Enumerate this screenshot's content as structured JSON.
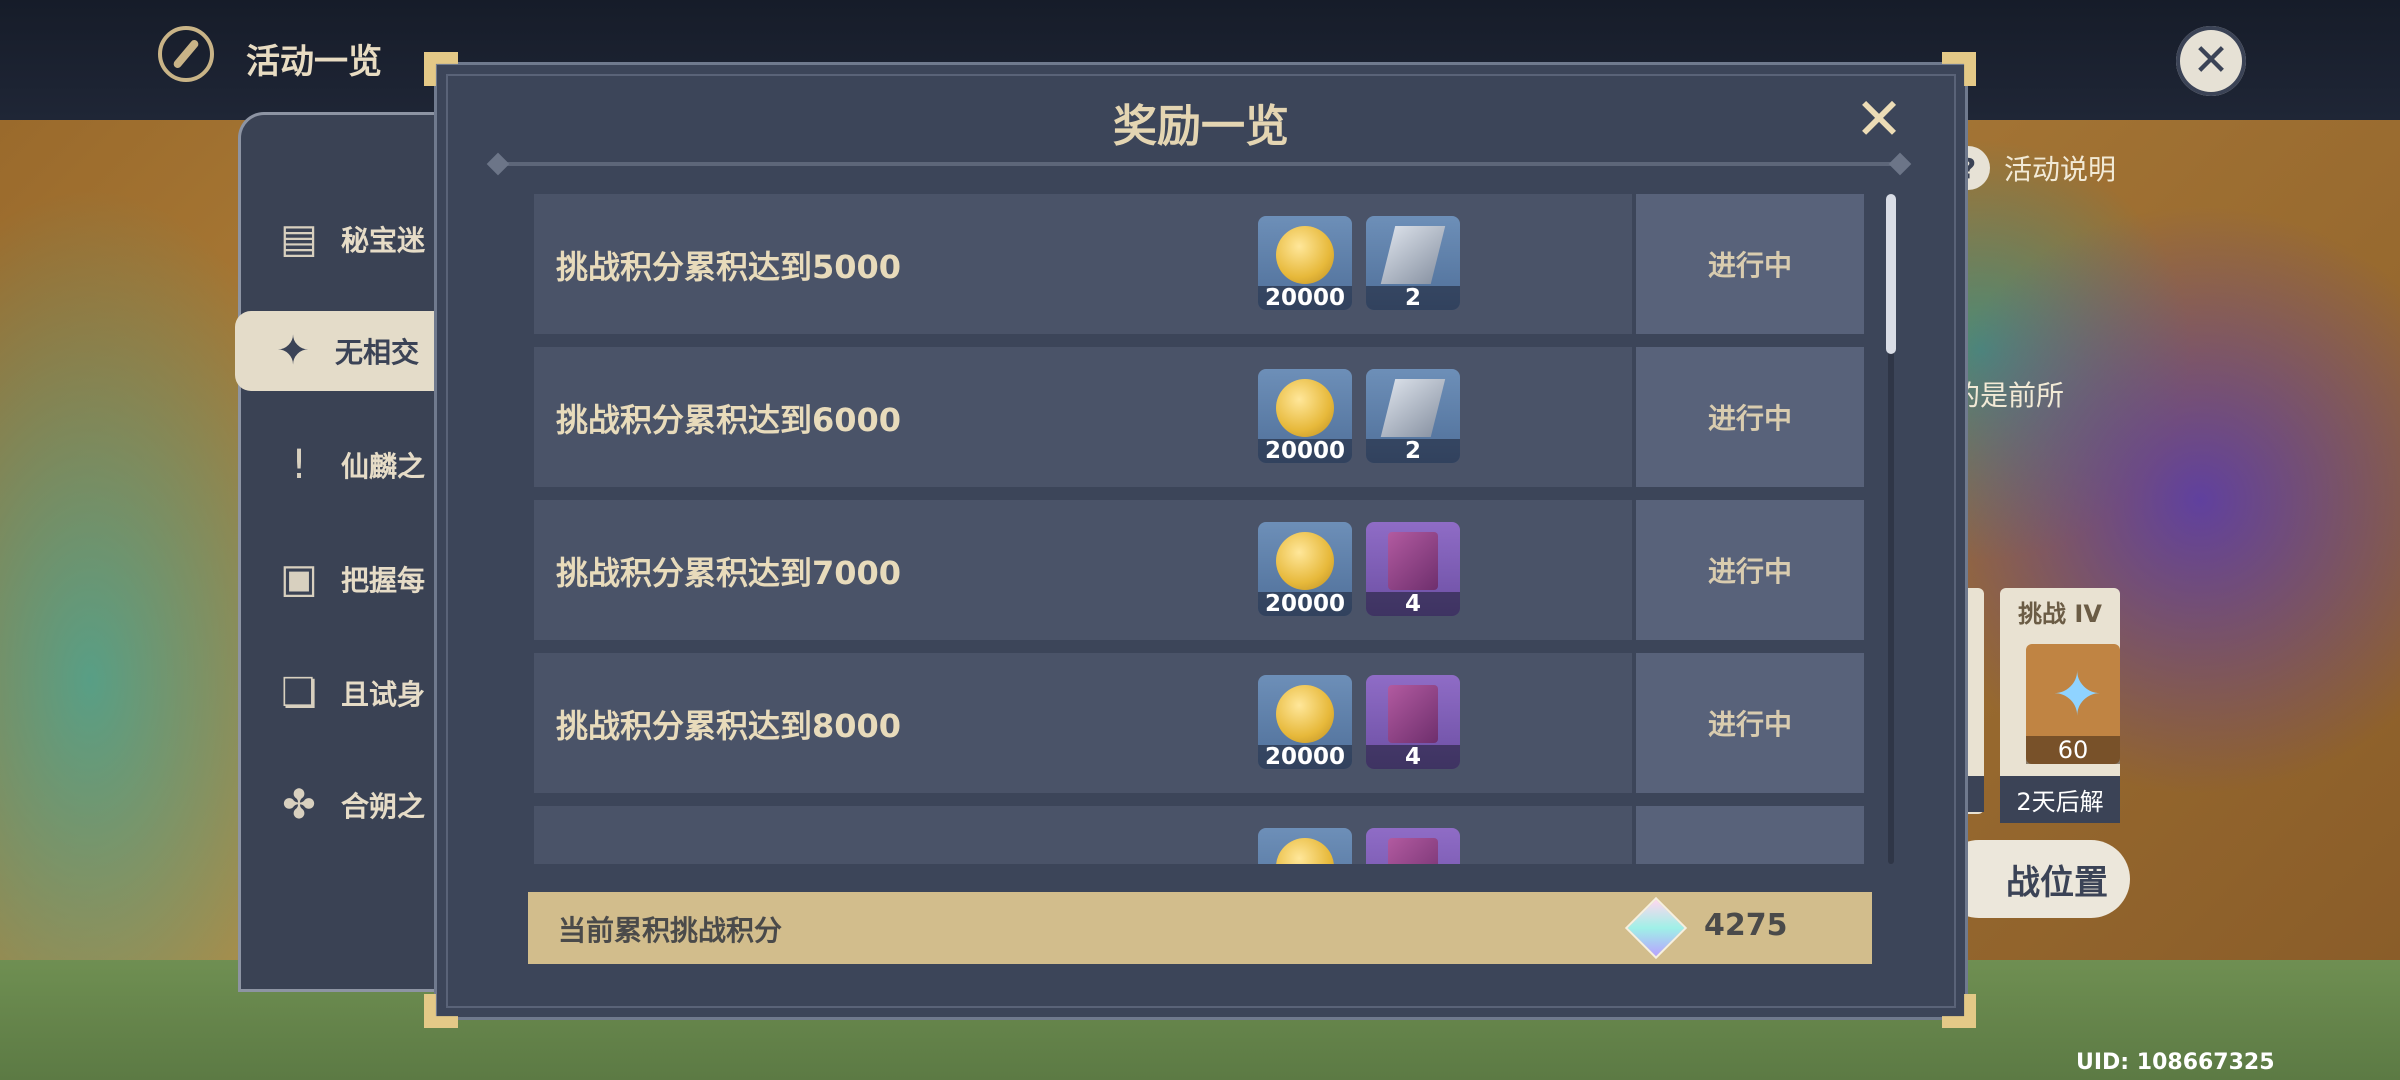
{
  "header": {
    "title": "活动一览"
  },
  "sidebar": {
    "items": [
      {
        "label": "秘宝迷",
        "icon": "chest-icon",
        "active": false
      },
      {
        "label": "无相交",
        "icon": "four-point-star-icon",
        "active": true
      },
      {
        "label": "仙麟之",
        "icon": "exclamation-icon",
        "active": false
      },
      {
        "label": "把握每",
        "icon": "calendar-icon",
        "active": false
      },
      {
        "label": "且试身",
        "icon": "cards-icon",
        "active": false
      },
      {
        "label": "合朔之",
        "icon": "tree-emblem-icon",
        "active": false
      }
    ]
  },
  "background": {
    "help_label": "活动说明",
    "description_fragment": "的是前所",
    "challenge_card": {
      "title": "挑战 IV",
      "count": "60",
      "status": "2天后解"
    },
    "position_button": "战位置",
    "uid": "UID: 108667325"
  },
  "modal": {
    "title": "奖励一览",
    "rewards": [
      {
        "condition": "挑战积分累积达到5000",
        "status": "进行中",
        "items": [
          {
            "icon": "mora-coin-icon",
            "count": "20000"
          },
          {
            "icon": "steel-material-icon",
            "count": "2"
          }
        ]
      },
      {
        "condition": "挑战积分累积达到6000",
        "status": "进行中",
        "items": [
          {
            "icon": "mora-coin-icon",
            "count": "20000"
          },
          {
            "icon": "steel-material-icon",
            "count": "2"
          }
        ]
      },
      {
        "condition": "挑战积分累积达到7000",
        "status": "进行中",
        "items": [
          {
            "icon": "mora-coin-icon",
            "count": "20000"
          },
          {
            "icon": "purple-book-icon",
            "count": "4"
          }
        ]
      },
      {
        "condition": "挑战积分累积达到8000",
        "status": "进行中",
        "items": [
          {
            "icon": "mora-coin-icon",
            "count": "20000"
          },
          {
            "icon": "purple-book-icon",
            "count": "4"
          }
        ]
      },
      {
        "condition": "",
        "status": "",
        "items": [
          {
            "icon": "mora-coin-icon",
            "count": ""
          },
          {
            "icon": "purple-book-icon",
            "count": ""
          }
        ]
      }
    ],
    "score": {
      "label": "当前累积挑战积分",
      "icon": "crystal-icon",
      "value": "4275"
    }
  }
}
